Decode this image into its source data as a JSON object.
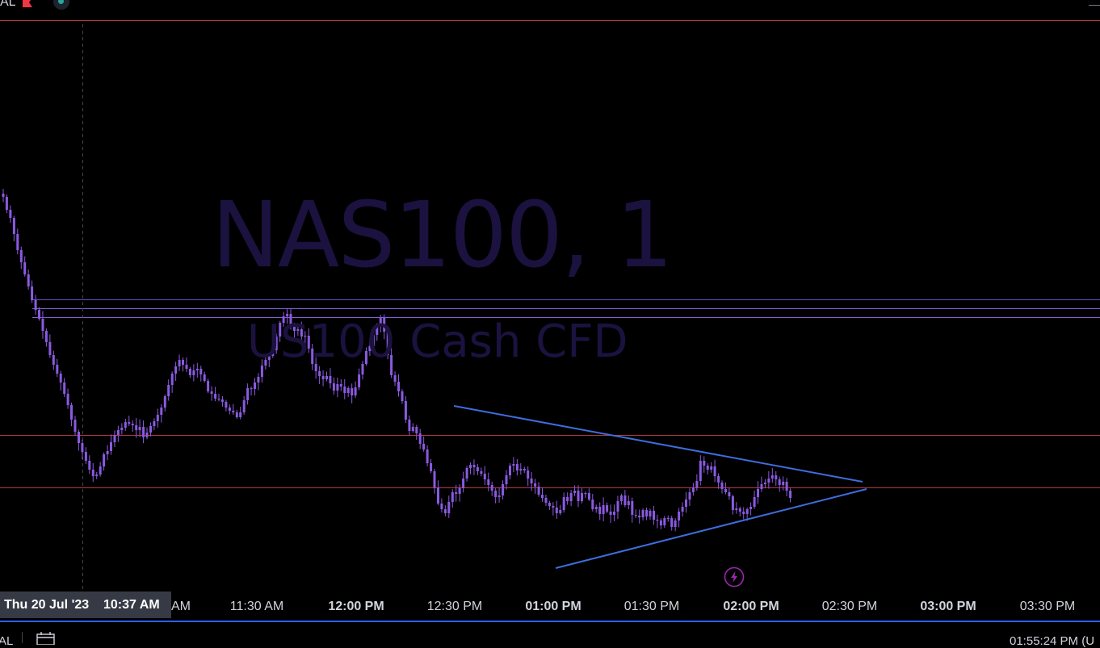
{
  "chart_data": {
    "type": "candlestick",
    "symbol": "NAS100, 1",
    "description": "US100 Cash CFD",
    "x_ticks": [
      "AM",
      "11:30 AM",
      "12:00 PM",
      "12:30 PM",
      "01:00 PM",
      "01:30 PM",
      "02:00 PM",
      "02:30 PM",
      "03:00 PM",
      "03:30 PM"
    ],
    "x_ticks_bold": [
      false,
      false,
      true,
      false,
      true,
      false,
      true,
      false,
      true,
      false
    ],
    "candle_closes": [
      244,
      260,
      270,
      290,
      310,
      325,
      340,
      355,
      372,
      384,
      395,
      410,
      424,
      440,
      452,
      463,
      474,
      488,
      502,
      520,
      535,
      549,
      560,
      571,
      582,
      590,
      588,
      578,
      563,
      559,
      548,
      539,
      533,
      530,
      523,
      525,
      527,
      533,
      529,
      542,
      536,
      528,
      522,
      514,
      505,
      491,
      477,
      463,
      454,
      446,
      452,
      457,
      465,
      459,
      457,
      464,
      472,
      485,
      488,
      494,
      495,
      498,
      505,
      509,
      511,
      517,
      511,
      496,
      481,
      482,
      474,
      467,
      453,
      446,
      441,
      434,
      417,
      400,
      392,
      389,
      403,
      410,
      408,
      417,
      416,
      432,
      451,
      460,
      466,
      470,
      466,
      475,
      484,
      476,
      479,
      487,
      481,
      490,
      480,
      464,
      451,
      435,
      429,
      415,
      404,
      394,
      411,
      440,
      465,
      473,
      485,
      497,
      520,
      534,
      529,
      537,
      550,
      557,
      574,
      584,
      604,
      624,
      631,
      636,
      622,
      610,
      612,
      605,
      593,
      580,
      576,
      579,
      584,
      587,
      594,
      601,
      608,
      616,
      614,
      600,
      589,
      577,
      575,
      583,
      581,
      583,
      593,
      599,
      603,
      613,
      617,
      623,
      627,
      629,
      636,
      632,
      616,
      621,
      611,
      608,
      621,
      611,
      611,
      619,
      631,
      628,
      637,
      626,
      634,
      638,
      634,
      621,
      614,
      626,
      621,
      638,
      639,
      641,
      632,
      640,
      633,
      644,
      645,
      651,
      642,
      642,
      653,
      645,
      634,
      628,
      619,
      610,
      604,
      596,
      571,
      577,
      582,
      578,
      590,
      598,
      606,
      610,
      615,
      632,
      630,
      634,
      637,
      631,
      628,
      616,
      606,
      600,
      598,
      593,
      589,
      594,
      601,
      597,
      608,
      617
    ],
    "h_levels": [
      {
        "y": 25.5,
        "color": "#b2393f"
      },
      {
        "y": 371.5,
        "color": "#6a4ec8"
      },
      {
        "y": 382.5,
        "color": "#8a5ad8"
      },
      {
        "y": 393.5,
        "color": "#8a5ad8"
      },
      {
        "y": 539.5,
        "color": "#b2393f"
      },
      {
        "y": 604.5,
        "color": "#b2393f"
      }
    ],
    "trendlines": [
      {
        "from": [
          562,
          503
        ],
        "to": [
          1068,
          597
        ]
      },
      {
        "from": [
          688,
          704
        ],
        "to": [
          1073,
          606
        ]
      }
    ],
    "crosshair_date": "Thu 20 Jul '23",
    "crosshair_time": "10:37 AM",
    "colors": {
      "candle": "#8a5ae0",
      "trendline": "#3f6dde",
      "support_line": "#b2393f",
      "resistance_band": "#7b52d6",
      "background": "#000000"
    }
  },
  "top_bar": {
    "left_text": "AL"
  },
  "bottom_bar": {
    "left_text": "AL",
    "clock": "01:55:24 PM (U"
  }
}
